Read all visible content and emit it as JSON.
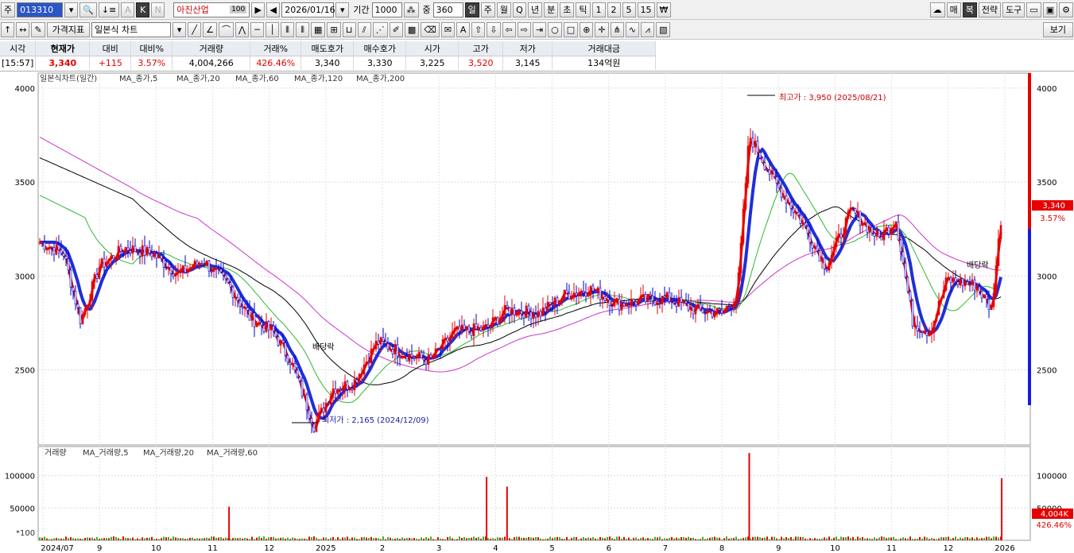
{
  "toolbar1": {
    "market_prefix": "주",
    "stock_code": "013310",
    "stock_name": "아진산업",
    "name_badge": "100",
    "date": "2026/01/16",
    "period_label": "기간",
    "period_value": "1000",
    "zoom_label": "중",
    "zoom_value": "360",
    "interval_buttons": [
      "일",
      "주",
      "월",
      "Q",
      "년",
      "분",
      "초",
      "틱",
      "1",
      "2",
      "5",
      "15",
      "₩"
    ],
    "right_buttons": [
      "매",
      "복",
      "전략",
      "도구"
    ]
  },
  "toolbar2": {
    "indicator_button": "가격지표",
    "chart_type": "일본식 차트",
    "view_button": "보기"
  },
  "quote": {
    "headers": [
      "시각",
      "현재가",
      "대비",
      "대비%",
      "거래량",
      "거래%",
      "매도호가",
      "매수호가",
      "시가",
      "고가",
      "저가",
      "거래대금"
    ],
    "values": [
      "[15:57]",
      "3,340",
      "+115",
      "3.57%",
      "4,004,266",
      "426.46%",
      "3,340",
      "3,330",
      "3,225",
      "3,520",
      "3,145",
      "134억원"
    ]
  },
  "price_panel": {
    "legend": [
      "일본식차트(일간)",
      "MA_종가,5",
      "MA_종가,20",
      "MA_종가,60",
      "MA_종가,120",
      "MA_종가,200"
    ],
    "high_annotation": "최고가 : 3,950 (2025/08/21)",
    "low_annotation": "최저가 : 2,165 (2024/12/09)",
    "dividend_label": "배당락",
    "current_price_tag": "3,340",
    "current_pct_tag": "3.57%"
  },
  "volume_panel": {
    "legend": [
      "거래량",
      "MA_거래량,5",
      "MA_거래량,20",
      "MA_거래량,60"
    ],
    "scale_label": "*100",
    "volume_tag": "4,004K",
    "volume_pct_tag": "426.46%"
  },
  "colors": {
    "up": "#e60000",
    "down": "#0000cc",
    "ma5": "#e60000",
    "ma20": "#1e2fd8",
    "ma60": "#2eb82e",
    "ma120": "#000000",
    "ma200": "#cc33cc"
  },
  "chart_data": {
    "type": "candlestick",
    "y_ticks": [
      "4000",
      "3500",
      "3000",
      "2500"
    ],
    "y_range": [
      2100,
      4080
    ],
    "volume_ticks": [
      "100000",
      "50000"
    ],
    "volume_range": [
      0,
      145000
    ],
    "x_labels": [
      "2024/07",
      "9",
      "10",
      "11",
      "12",
      "2025",
      "2",
      "3",
      "4",
      "5",
      "6",
      "7",
      "8",
      "9",
      "10",
      "11",
      "12",
      "2026"
    ],
    "close_path": [
      {
        "date": "2024-07-01",
        "close": 3180
      },
      {
        "date": "2024-07-15",
        "close": 3120
      },
      {
        "date": "2024-07-25",
        "close": 2760
      },
      {
        "date": "2024-08-05",
        "close": 3050
      },
      {
        "date": "2024-08-20",
        "close": 3150
      },
      {
        "date": "2024-09-05",
        "close": 3120
      },
      {
        "date": "2024-09-20",
        "close": 3010
      },
      {
        "date": "2024-10-05",
        "close": 3080
      },
      {
        "date": "2024-10-20",
        "close": 2950
      },
      {
        "date": "2024-11-01",
        "close": 2780
      },
      {
        "date": "2024-11-15",
        "close": 2700
      },
      {
        "date": "2024-11-25",
        "close": 2550
      },
      {
        "date": "2024-12-09",
        "close": 2200
      },
      {
        "date": "2024-12-20",
        "close": 2400
      },
      {
        "date": "2025-01-01",
        "close": 2430
      },
      {
        "date": "2025-01-15",
        "close": 2650
      },
      {
        "date": "2025-02-01",
        "close": 2580
      },
      {
        "date": "2025-02-15",
        "close": 2550
      },
      {
        "date": "2025-03-01",
        "close": 2700
      },
      {
        "date": "2025-03-20",
        "close": 2720
      },
      {
        "date": "2025-04-01",
        "close": 2820
      },
      {
        "date": "2025-04-20",
        "close": 2800
      },
      {
        "date": "2025-05-05",
        "close": 2900
      },
      {
        "date": "2025-05-20",
        "close": 2930
      },
      {
        "date": "2025-06-05",
        "close": 2850
      },
      {
        "date": "2025-06-20",
        "close": 2870
      },
      {
        "date": "2025-07-05",
        "close": 2880
      },
      {
        "date": "2025-07-20",
        "close": 2820
      },
      {
        "date": "2025-08-05",
        "close": 2800
      },
      {
        "date": "2025-08-14",
        "close": 2900
      },
      {
        "date": "2025-08-21",
        "close": 3750
      },
      {
        "date": "2025-09-05",
        "close": 3500
      },
      {
        "date": "2025-09-20",
        "close": 3300
      },
      {
        "date": "2025-10-05",
        "close": 3050
      },
      {
        "date": "2025-10-20",
        "close": 3350
      },
      {
        "date": "2025-11-05",
        "close": 3200
      },
      {
        "date": "2025-11-15",
        "close": 3300
      },
      {
        "date": "2025-11-25",
        "close": 2750
      },
      {
        "date": "2025-12-05",
        "close": 2700
      },
      {
        "date": "2025-12-15",
        "close": 2980
      },
      {
        "date": "2026-01-01",
        "close": 2950
      },
      {
        "date": "2026-01-10",
        "close": 2820
      },
      {
        "date": "2026-01-16",
        "close": 3340
      }
    ],
    "volume_spikes": [
      {
        "date": "2025-03-20",
        "volume": 98000
      },
      {
        "date": "2025-04-01",
        "volume": 83000
      },
      {
        "date": "2024-10-20",
        "volume": 52000
      },
      {
        "date": "2025-08-21",
        "volume": 135000
      },
      {
        "date": "2026-01-16",
        "volume": 96000
      }
    ]
  }
}
